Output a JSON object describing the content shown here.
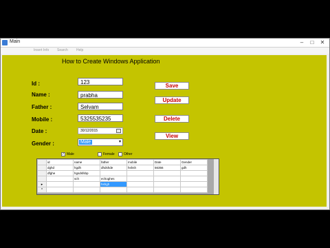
{
  "window": {
    "title": "Main",
    "minimize_glyph": "–",
    "maximize_glyph": "□",
    "close_glyph": "✕"
  },
  "menu": [
    "Insert Info",
    "Search",
    "Help"
  ],
  "heading": "How to Create Windows Application",
  "form": {
    "id_label": "Id   :",
    "id_value": "123",
    "name_label": "Name  :",
    "name_value": "prabha",
    "father_label": "Father  :",
    "father_value": "Selvam",
    "mobile_label": "Mobile  :",
    "mobile_value": "5325535235",
    "date_label": "Date  :",
    "date_value": "30/12/2015",
    "gender_label": "Gender  :",
    "gender_value": "Male"
  },
  "buttons": {
    "save": "Save",
    "update": "Update",
    "delete": "Delete",
    "view": "View"
  },
  "options": {
    "male": "Male",
    "male_checked": true,
    "female": "Female",
    "female_checked": false,
    "other": "Other",
    "other_checked": false
  },
  "grid": {
    "columns": [
      "id",
      "name",
      "father",
      "mobile",
      "Date",
      "Gender"
    ],
    "rows": [
      [
        "dghd",
        "hgdh",
        "dhdshde",
        "hshsh",
        "56356",
        "gdh"
      ],
      [
        "dfghe",
        "hgsdsfsbp",
        "",
        "",
        "",
        ""
      ],
      [
        "",
        "sch",
        "echoghes",
        "",
        "",
        ""
      ],
      [
        "",
        "",
        "hshgh",
        "",
        "",
        ""
      ],
      [
        "",
        "",
        "",
        "",
        "",
        ""
      ]
    ],
    "row_markers": [
      "",
      "",
      "",
      "▸",
      "*"
    ]
  },
  "colors": {
    "client_background": "#c4c400",
    "button_text": "#c80000",
    "selection": "#3399ff"
  }
}
